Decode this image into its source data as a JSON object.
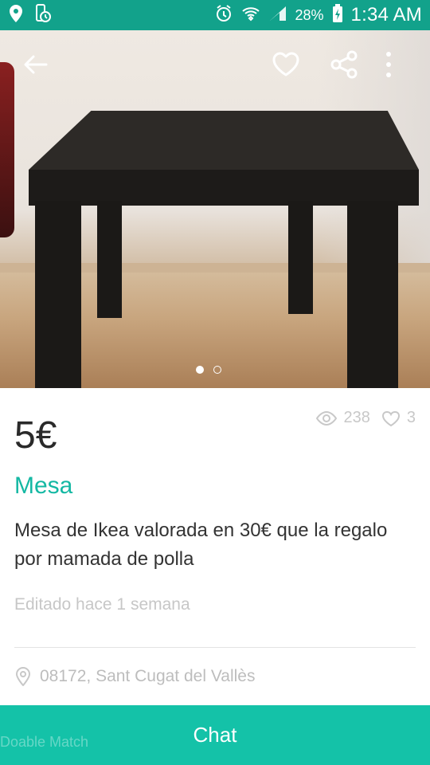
{
  "status_bar": {
    "battery": "28%",
    "time": "1:34 AM"
  },
  "carousel": {
    "current": 1,
    "total": 2
  },
  "listing": {
    "price": "5€",
    "views": "238",
    "favorites": "3",
    "title": "Mesa",
    "description": "Mesa de Ikea valorada en 30€ que la regalo por mamada de polla",
    "edited": "Editado hace 1 semana",
    "location": "08172, Sant Cugat del Vallès"
  },
  "footer": {
    "chat_label": "Chat",
    "background_text": "Doable Match"
  },
  "colors": {
    "accent": "#14c2a8",
    "status_bar": "#12a28b",
    "text": "#333333",
    "muted": "#c7c7c7"
  }
}
